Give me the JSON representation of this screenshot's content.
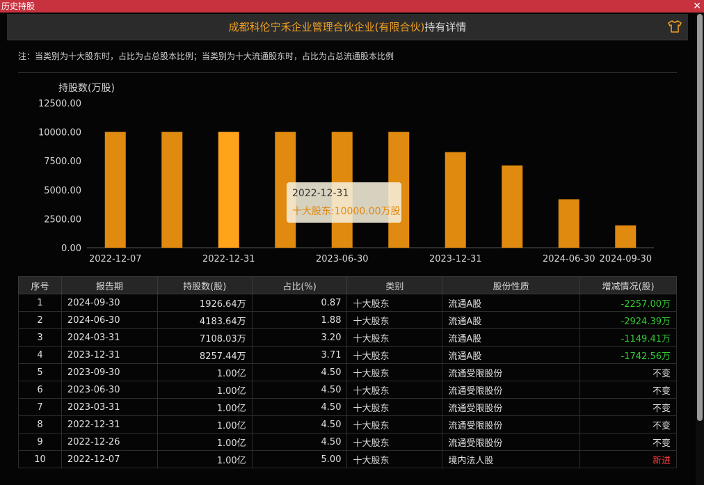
{
  "window": {
    "title": "历史持股",
    "close_glyph": "✕"
  },
  "header": {
    "name": "成都科伦宁禾企业管理合伙企业(有限合伙)",
    "suffix": "持有详情",
    "icon": "tshirt-icon"
  },
  "note": "注：当类别为十大股东时，占比为占总股本比例；当类别为十大流通股东时，占比为占总流通股本比例",
  "chart_data": {
    "type": "bar",
    "ylabel": "持股数(万股)",
    "yticks": [
      "12500.00",
      "10000.00",
      "7500.00",
      "5000.00",
      "2500.00",
      "0.00"
    ],
    "ylim": [
      0,
      12500
    ],
    "categories": [
      "2022-12-07",
      "2022-12-26",
      "2022-12-31",
      "2023-03-31",
      "2023-06-30",
      "2023-09-30",
      "2023-12-31",
      "2024-03-31",
      "2024-06-30",
      "2024-09-30"
    ],
    "values": [
      10000,
      10000,
      10000,
      10000,
      10000,
      10000,
      8257.44,
      7108.03,
      4183.64,
      1926.64
    ],
    "xticks": [
      "2022-12-07",
      "2022-12-31",
      "2023-06-30",
      "2023-12-31",
      "2024-06-30",
      "2024-09-30"
    ],
    "bar_color": "#e08a10",
    "highlight_color": "#ffa31a",
    "highlight_index": 2,
    "tooltip": {
      "date": "2022-12-31",
      "text": "十大股东:10000.00万股"
    }
  },
  "table": {
    "headers": [
      "序号",
      "报告期",
      "持股数(股)",
      "占比(%)",
      "类别",
      "股份性质",
      "增减情况(股)"
    ],
    "rows": [
      [
        "1",
        "2024-09-30",
        "1926.64万",
        "0.87",
        "十大股东",
        "流通A股",
        "-2257.00万"
      ],
      [
        "2",
        "2024-06-30",
        "4183.64万",
        "1.88",
        "十大股东",
        "流通A股",
        "-2924.39万"
      ],
      [
        "3",
        "2024-03-31",
        "7108.03万",
        "3.20",
        "十大股东",
        "流通A股",
        "-1149.41万"
      ],
      [
        "4",
        "2023-12-31",
        "8257.44万",
        "3.71",
        "十大股东",
        "流通A股",
        "-1742.56万"
      ],
      [
        "5",
        "2023-09-30",
        "1.00亿",
        "4.50",
        "十大股东",
        "流通受限股份",
        "不变"
      ],
      [
        "6",
        "2023-06-30",
        "1.00亿",
        "4.50",
        "十大股东",
        "流通受限股份",
        "不变"
      ],
      [
        "7",
        "2023-03-31",
        "1.00亿",
        "4.50",
        "十大股东",
        "流通受限股份",
        "不变"
      ],
      [
        "8",
        "2022-12-31",
        "1.00亿",
        "4.50",
        "十大股东",
        "流通受限股份",
        "不变"
      ],
      [
        "9",
        "2022-12-26",
        "1.00亿",
        "4.50",
        "十大股东",
        "流通受限股份",
        "不变"
      ],
      [
        "10",
        "2022-12-07",
        "1.00亿",
        "5.00",
        "十大股东",
        "境内法人股",
        "新进"
      ]
    ],
    "change_colors": {
      "decrease": "#32c832",
      "unchanged": "#e0e0e0",
      "new": "#ff3b3b"
    }
  }
}
